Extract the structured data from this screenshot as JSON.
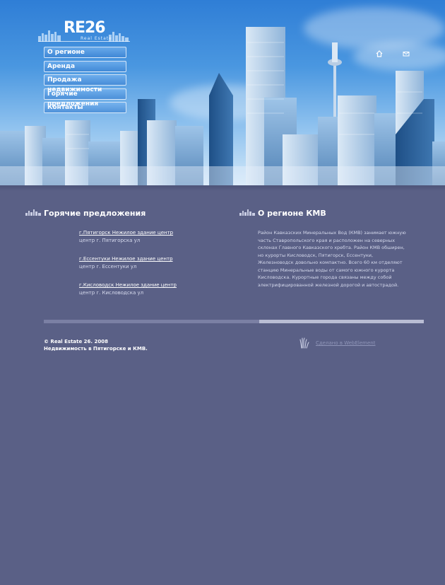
{
  "logo": {
    "text": "RE26",
    "subtitle": "Real Estate"
  },
  "menu": [
    {
      "label": "О регионе"
    },
    {
      "label": "Аренда"
    },
    {
      "label": "Продажа недвижимости"
    },
    {
      "label": "Горячие предложения"
    },
    {
      "label": "Контакты"
    }
  ],
  "header_icons": {
    "home": "home-icon",
    "mail": "mail-icon"
  },
  "hot_offers": {
    "title": "Горячие предложения",
    "items": [
      {
        "link": "г.Пятигорск Нежилое здание центр",
        "address": "центр г. Пятигорска ул"
      },
      {
        "link": "г.Ессентуки Нежилое здание центр",
        "address": "центр г. Ессентуки ул"
      },
      {
        "link": "г.Кисловодск Нежилое здание центр",
        "address": "центр г. Кисловодска ул"
      }
    ]
  },
  "about": {
    "title": "О регионе КМВ",
    "text": "Район Кавказских Минеральных Вод (КМВ) занимает южную часть Ставропольского края и расположен на северных склонах Главного Кавказского хребта. Район КМВ обширен, но курорты Кисловодск, Пятигорск, Ессентуки, Железноводск довольно компактно. Всего 60 км отделяют станцию Минеральные воды от самого южного курорта Кисловодска. Курортные города связаны между собой электрифицированной железной дорогой и автострадой."
  },
  "footer": {
    "copyright": "© Real Estate 26. 2008",
    "tagline": "Недвижимость в Пятигорске и КМВ.",
    "made_by": "Сделано в WebElement"
  },
  "colors": {
    "background": "#5a6086",
    "sky": "#3a88dc",
    "divider_light": "#b9bdd4"
  }
}
